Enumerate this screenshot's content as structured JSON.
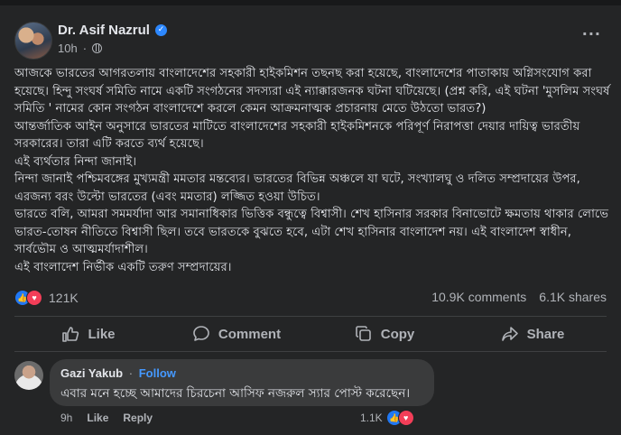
{
  "post": {
    "author": "Dr. Asif Nazrul",
    "time": "10h",
    "more_icon": "···",
    "body": "আজকে ভারতের আগরতলায় বাংলাদেশের সহকারী হাইকমিশন তছনছ করা হয়েছে, বাংলাদেশের পাতাকায় অগ্নিসংযোগ করা হয়েছে। হিন্দু সংঘর্ষ সমিতি নামে একটি সংগঠনের সদস্যরা এই ন্যাক্কারজনক ঘটনা ঘটিয়েছে। (প্রশ্ন করি, এই ঘটনা 'মুসলিম সংঘর্ষ সমিতি ' নামের কোন সংগঠন বাংলাদেশে করলে কেমন আক্রমনাত্মক প্রচারনায় মেতে উঠতো ভারত?)\nআন্তর্জাতিক আইন অনুসারে ভারতের মাটিতে বাংলাদেশের সহকারী হাইকমিশনকে পরিপূর্ণ নিরাপত্তা দেয়ার দায়িত্ব ভারতীয় সরকারের। তারা এটি করতে ব্যর্থ হয়েছে।\nএই ব্যর্থতার নিন্দা জানাই।\nনিন্দা জানাই পশ্চিমবঙ্গের মুখ্যমন্ত্রী মমতার মন্তব্যের। ভারতের বিভিন্ন অঞ্চলে যা ঘটে, সংখ্যালঘু ও দলিত সম্প্রদায়ের উপর, এরজন্য বরং উল্টো ভারতের (এবং মমতার) লজ্জিত হওয়া উচিত।\nভারতে বলি, আমরা সমমর্যাদা আর সমানাধিকার ভিত্তিক বন্ধুত্বে বিশ্বাসী। শেখ হাসিনার সরকার বিনাভোটে ক্ষমতায় থাকার লোভে ভারত-তোষন নীতিতে বিশ্বাসী ছিল। তবে ভারতকে বুঝতে হবে, এটা শেখ হাসিনার বাংলাদেশ নয়। এই বাংলাদেশ স্বাধীন, সার্বভৌম ও আত্মমর্যাদাশীল।\nএই বাংলাদেশ নির্ভীক একটি তরুণ সম্প্রদায়ের।"
  },
  "stats": {
    "reactions": "121K",
    "comments": "10.9K comments",
    "shares": "6.1K shares"
  },
  "actions": {
    "like": "Like",
    "comment": "Comment",
    "copy": "Copy",
    "share": "Share"
  },
  "comment": {
    "author": "Gazi Yakub",
    "separator": "·",
    "follow": "Follow",
    "text": "এবার মনে হচ্ছে আমাদের চিরচেনা আসিফ নজরুল স্যার পোস্ট করেছেন।",
    "time": "9h",
    "like": "Like",
    "reply": "Reply",
    "reactions": "1.1K"
  },
  "colors": {
    "background": "#242526",
    "text": "#e4e6eb",
    "muted": "#b0b3b8",
    "accent": "#2d88ff",
    "love": "#f33e58"
  },
  "icons": [
    "verified-badge-icon",
    "globe-icon",
    "more-options-icon",
    "like-reaction-icon",
    "love-reaction-icon",
    "thumbs-up-icon",
    "comment-icon",
    "copy-icon",
    "share-icon"
  ]
}
